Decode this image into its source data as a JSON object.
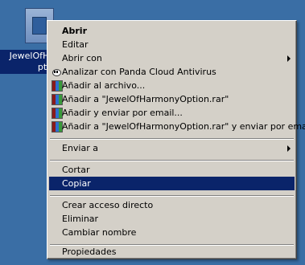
{
  "desktop_icon": {
    "label_line1": "JewelOfHa",
    "label_line2": "ptio"
  },
  "menu": {
    "items": [
      {
        "label": "Abrir"
      },
      {
        "label": "Editar"
      },
      {
        "label": "Abrir con"
      },
      {
        "label": "Analizar con Panda Cloud Antivirus"
      },
      {
        "label": "Añadir al archivo..."
      },
      {
        "label": "Añadir a \"JewelOfHarmonyOption.rar\""
      },
      {
        "label": "Añadir y enviar por email..."
      },
      {
        "label": "Añadir a \"JewelOfHarmonyOption.rar\" y enviar por email"
      },
      {
        "label": "Enviar a"
      },
      {
        "label": "Cortar"
      },
      {
        "label": "Copiar"
      },
      {
        "label": "Crear acceso directo"
      },
      {
        "label": "Eliminar"
      },
      {
        "label": "Cambiar nombre"
      },
      {
        "label": "Propiedades"
      }
    ],
    "highlighted": "Copiar",
    "colors": {
      "menu_bg": "#d4d0c8",
      "highlight_bg": "#0a246a",
      "desktop_bg": "#3a6ea5"
    },
    "icons": {
      "scan": "panda-antivirus-icon",
      "winrar": "winrar-icon"
    }
  }
}
